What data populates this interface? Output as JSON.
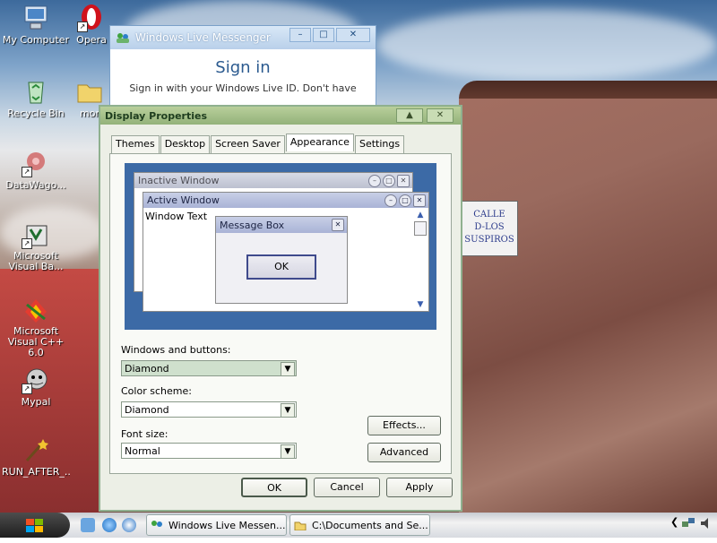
{
  "desktop": {
    "icons": [
      {
        "label": "My Computer",
        "icon": "computer-icon"
      },
      {
        "label": "Opera",
        "icon": "opera-icon"
      },
      {
        "label": "Recycle Bin",
        "icon": "recycle-bin-icon"
      },
      {
        "label": "mor",
        "icon": "folder-icon"
      },
      {
        "label": "DataWago...",
        "icon": "datawagon-icon"
      },
      {
        "label": "Microsoft Visual Ba...",
        "icon": "visual-basic-icon"
      },
      {
        "label": "Microsoft Visual C++ 6.0",
        "icon": "visual-cpp-icon"
      },
      {
        "label": "Mypal",
        "icon": "mypal-icon"
      },
      {
        "label": "RUN_AFTER_...",
        "icon": "wand-icon"
      }
    ],
    "plaque": [
      "CALLE",
      "D-LOS",
      "SUSPIROS"
    ]
  },
  "messenger": {
    "title": "Windows Live Messenger",
    "signin": "Sign in",
    "hint": "Sign in with your Windows Live ID. Don't have"
  },
  "display_props": {
    "title": "Display Properties",
    "tabs": [
      "Themes",
      "Desktop",
      "Screen Saver",
      "Appearance",
      "Settings"
    ],
    "preview": {
      "inactive_title": "Inactive Window",
      "active_title": "Active Window",
      "window_text": "Window Text",
      "message_box_title": "Message Box",
      "ok": "OK"
    },
    "windows_buttons_label": "Windows and buttons:",
    "windows_buttons_value": "Diamond",
    "color_scheme_label": "Color scheme:",
    "color_scheme_value": "Diamond",
    "font_size_label": "Font size:",
    "font_size_value": "Normal",
    "effects": "Effects...",
    "advanced": "Advanced",
    "ok": "OK",
    "cancel": "Cancel",
    "apply": "Apply"
  },
  "taskbar": {
    "tasks": [
      "Windows Live Messen...",
      "C:\\Documents and Se..."
    ]
  },
  "colors": {
    "preview_bg": "#3c6aa6",
    "accent": "#8fb08f"
  }
}
